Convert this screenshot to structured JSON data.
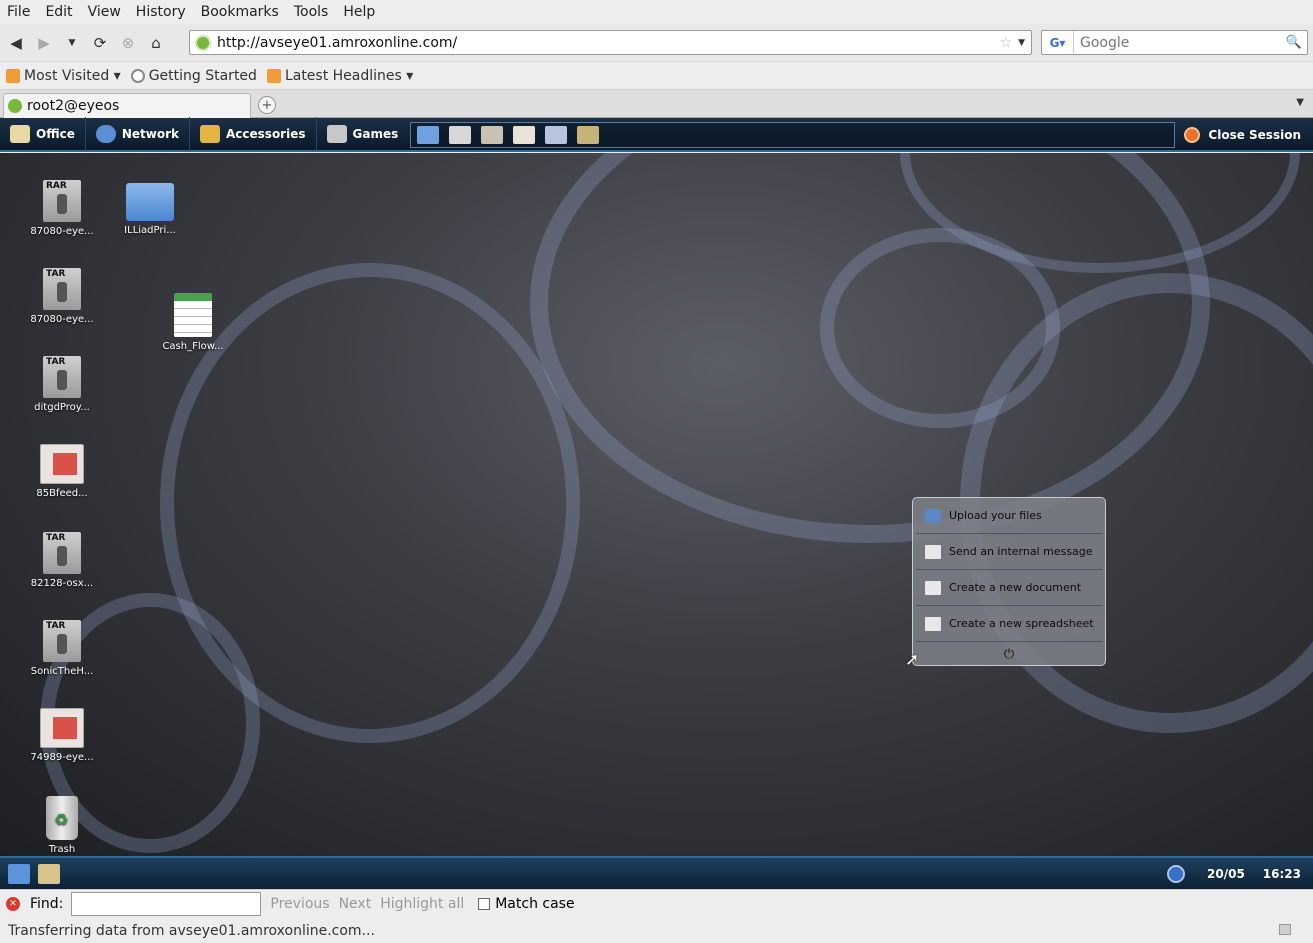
{
  "menubar": [
    "File",
    "Edit",
    "View",
    "History",
    "Bookmarks",
    "Tools",
    "Help"
  ],
  "nav": {
    "url": "http://avseye01.amroxonline.com/",
    "search_placeholder": "Google"
  },
  "bookmarks": [
    {
      "label": "Most Visited ▾",
      "icon": "rss-icon"
    },
    {
      "label": "Getting Started",
      "icon": "page-icon"
    },
    {
      "label": "Latest Headlines ▾",
      "icon": "rss-icon"
    }
  ],
  "tab": {
    "title": "root2@eyeos"
  },
  "eyeos_menu": [
    "Office",
    "Network",
    "Accessories",
    "Games"
  ],
  "close_session": "Close Session",
  "desktop_icons": {
    "i1": {
      "label": "87080-eye...",
      "badge": "RAR"
    },
    "i2": {
      "label": "ILLiadPri..."
    },
    "i3": {
      "label": "87080-eye...",
      "badge": "TAR"
    },
    "i4": {
      "label": "Cash_Flow..."
    },
    "i5": {
      "label": "ditgdProy...",
      "badge": "TAR"
    },
    "i6": {
      "label": "85Bfeed..."
    },
    "i7": {
      "label": "82128-osx...",
      "badge": "TAR"
    },
    "i8": {
      "label": "SonicTheH...",
      "badge": "TAR"
    },
    "i9": {
      "label": "74989-eye..."
    },
    "i10": {
      "label": "Trash"
    }
  },
  "popup": {
    "items": [
      "Upload your files",
      "Send an internal message",
      "Create a new document",
      "Create a new spreadsheet"
    ],
    "power": "⏻"
  },
  "tray": {
    "date": "20/05",
    "time": "16:23"
  },
  "find": {
    "label": "Find:",
    "previous": "Previous",
    "next": "Next",
    "highlight": "Highlight all",
    "match_case": "Match case"
  },
  "status": "Transferring data from avseye01.amroxonline.com..."
}
